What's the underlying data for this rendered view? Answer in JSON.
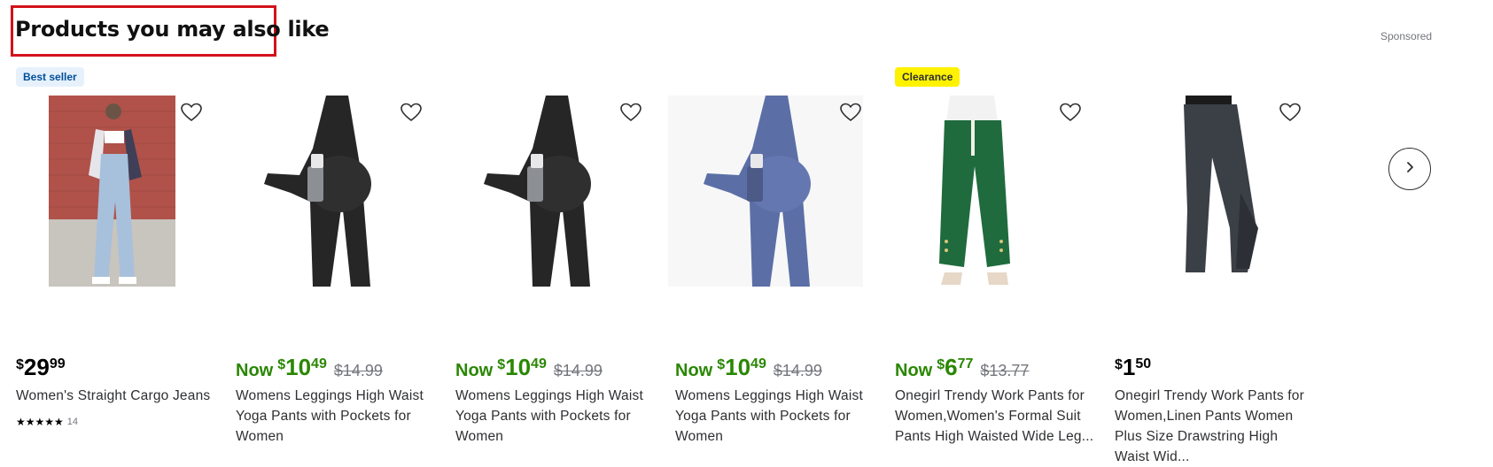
{
  "section": {
    "title": "Products you may also like",
    "sponsored": "Sponsored"
  },
  "products": [
    {
      "badge": "Best seller",
      "price": {
        "now_label": "",
        "currency": "$",
        "dollars": "29",
        "cents": "99",
        "was": ""
      },
      "title": "Women's Straight Cargo Jeans",
      "rating": {
        "stars": "★★★★★",
        "count": "14"
      }
    },
    {
      "badge": "",
      "price": {
        "now_label": "Now",
        "currency": "$",
        "dollars": "10",
        "cents": "49",
        "was": "$14.99"
      },
      "title": "Womens Leggings High Waist Yoga Pants with Pockets for Women"
    },
    {
      "badge": "",
      "price": {
        "now_label": "Now",
        "currency": "$",
        "dollars": "10",
        "cents": "49",
        "was": "$14.99"
      },
      "title": "Womens Leggings High Waist Yoga Pants with Pockets for Women"
    },
    {
      "badge": "",
      "price": {
        "now_label": "Now",
        "currency": "$",
        "dollars": "10",
        "cents": "49",
        "was": "$14.99"
      },
      "title": "Womens Leggings High Waist Yoga Pants with Pockets for Women"
    },
    {
      "badge": "Clearance",
      "price": {
        "now_label": "Now",
        "currency": "$",
        "dollars": "6",
        "cents": "77",
        "was": "$13.77"
      },
      "title": "Onegirl Trendy Work Pants for Women,Women's Formal Suit Pants High Waisted Wide Leg..."
    },
    {
      "badge": "",
      "price": {
        "now_label": "",
        "currency": "$",
        "dollars": "1",
        "cents": "50",
        "was": ""
      },
      "title": "Onegirl Trendy Work Pants for Women,Linen Pants Women Plus Size Drawstring High Waist Wid..."
    }
  ],
  "colors": {
    "highlight_box": "#d3121b",
    "sale_price": "#2a8703",
    "best_seller_bg": "#e6f1fc",
    "clearance_bg": "#fff200"
  },
  "icons": {
    "favorite": "heart-outline-icon",
    "next": "chevron-right-icon"
  }
}
